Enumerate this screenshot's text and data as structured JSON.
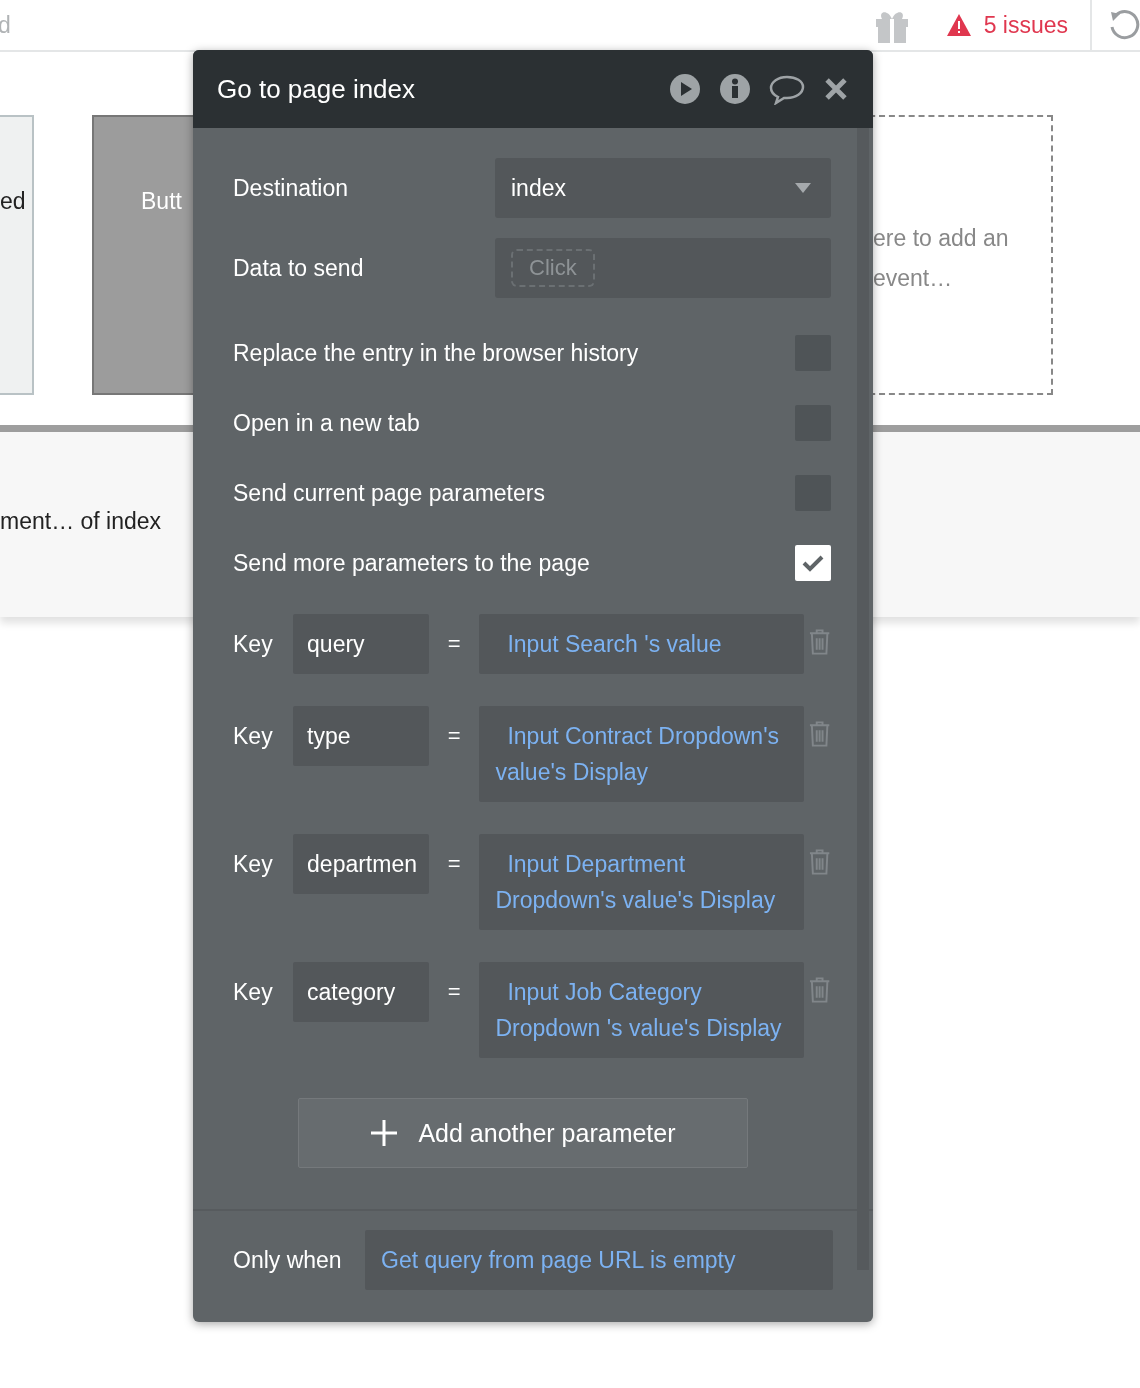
{
  "top_bar": {
    "left_text": "d",
    "issues": "5 issues"
  },
  "canvas": {
    "left_element_text": "ed",
    "button_element_text": "Butt",
    "event_placeholder": "ere to add an event…",
    "workflow_label": "ment… of index"
  },
  "popup": {
    "title": "Go to page index",
    "fields": [
      {
        "kind": "dropdown",
        "label": "Destination",
        "value": "index"
      },
      {
        "kind": "expression",
        "label": "Data to send",
        "placeholder": "Click"
      }
    ],
    "options": [
      {
        "label": "Replace the entry in the browser history",
        "checked": false
      },
      {
        "label": "Open in a new tab",
        "checked": false
      },
      {
        "label": "Send current page parameters",
        "checked": false
      },
      {
        "label": "Send more parameters to the page",
        "checked": true
      }
    ],
    "parameters": [
      {
        "key_label": "Key",
        "key": "query",
        "operator": "=",
        "value": "Input Search 's value"
      },
      {
        "key_label": "Key",
        "key": "type",
        "operator": "=",
        "value": "Input Contract Dropdown's value's Display"
      },
      {
        "key_label": "Key",
        "key": "departmen",
        "operator": "=",
        "value": "Input Department Dropdown's value's Display"
      },
      {
        "key_label": "Key",
        "key": "category",
        "operator": "=",
        "value": "Input Job Category Dropdown 's value's Display"
      }
    ],
    "add_button": "Add another parameter",
    "condition": {
      "label": "Only when",
      "value": "Get query from page URL is empty"
    }
  }
}
